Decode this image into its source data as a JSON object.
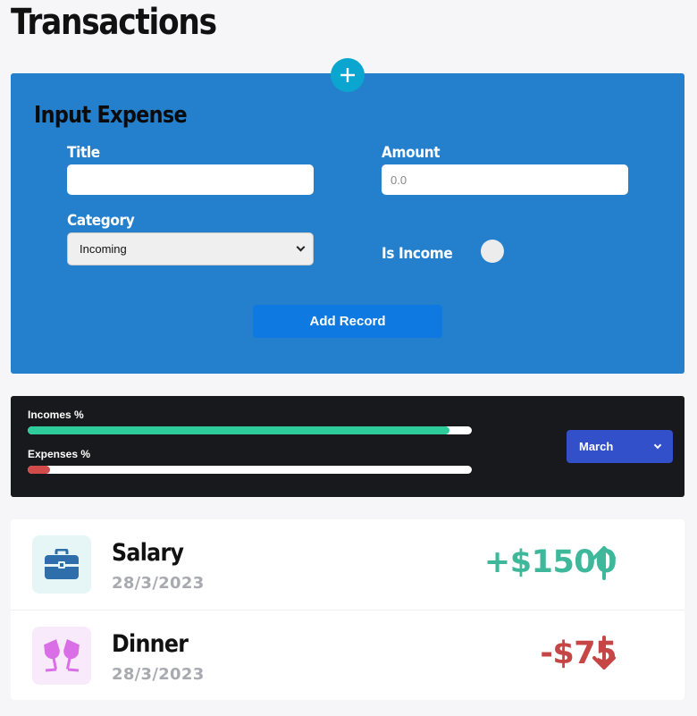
{
  "page": {
    "title": "Transactions"
  },
  "form": {
    "add_icon": "plus-icon",
    "heading": "Input Expense",
    "title_label": "Title",
    "title_value": "",
    "amount_label": "Amount",
    "amount_placeholder": "0.0",
    "category_label": "Category",
    "category_selected": "Incoming",
    "is_income_label": "Is Income",
    "is_income_on": false,
    "submit_label": "Add Record",
    "background": "#2480cc",
    "button_color": "#0e79e0"
  },
  "stats": {
    "incomes_label": "Incomes %",
    "incomes_pct": 95,
    "incomes_color": "#2ecc9a",
    "expenses_label": "Expenses %",
    "expenses_pct": 5,
    "expenses_color": "#d24b4b",
    "month_selected": "March",
    "month_select_color": "#3150c9"
  },
  "transactions": [
    {
      "title": "Salary",
      "date": "28/3/2023",
      "amount": "+$1500",
      "direction": "up",
      "color": "#3db89a",
      "icon": "briefcase-icon",
      "icon_bg": "#e6f6f6",
      "icon_color": "#2e6eab"
    },
    {
      "title": "Dinner",
      "date": "28/3/2023",
      "amount": "-$75",
      "direction": "down",
      "color": "#c64545",
      "icon": "wine-glasses-icon",
      "icon_bg": "#f8eafb",
      "icon_color": "#d96ee6"
    }
  ]
}
